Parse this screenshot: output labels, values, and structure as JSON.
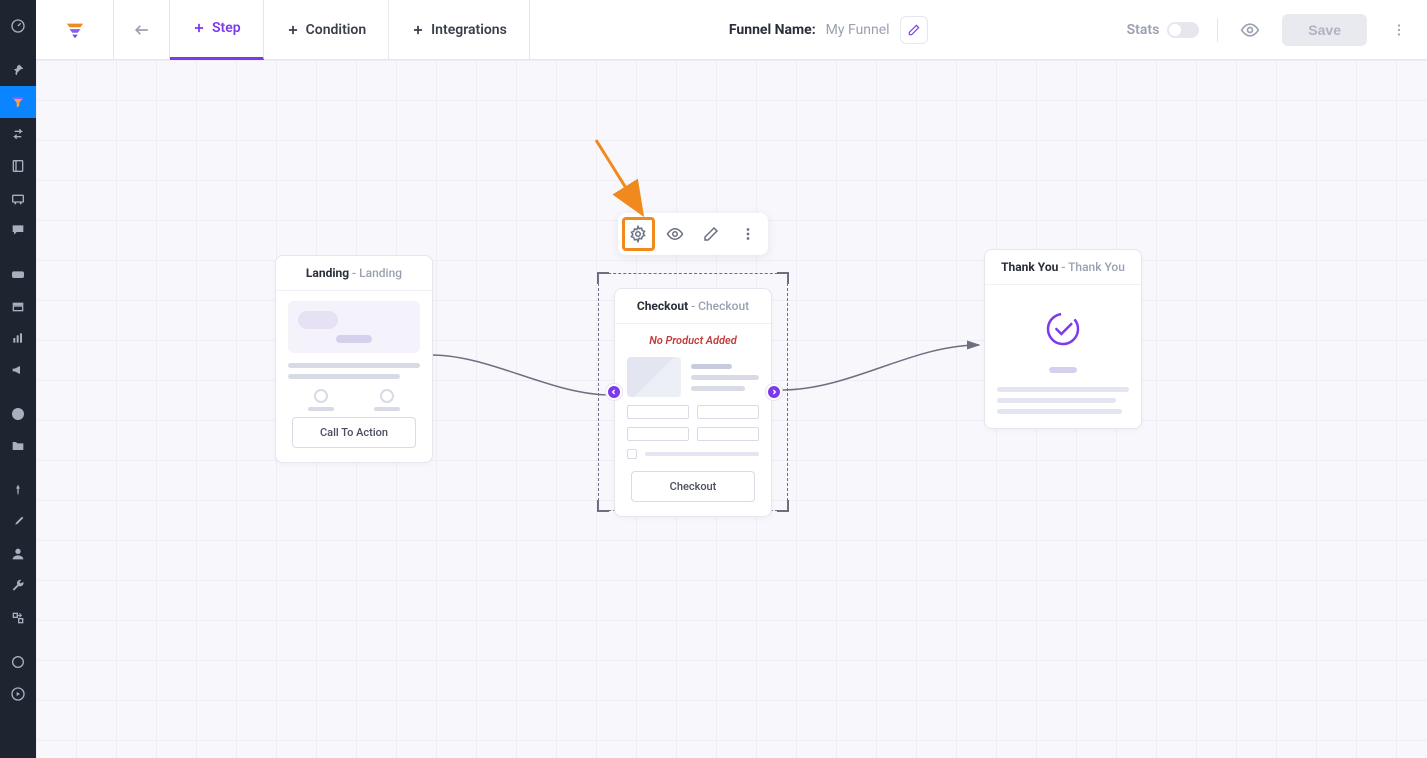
{
  "topbar": {
    "tabs": {
      "step": "Step",
      "condition": "Condition",
      "integrations": "Integrations"
    },
    "funnel_label": "Funnel Name:",
    "funnel_name": "My Funnel",
    "stats_label": "Stats",
    "save_label": "Save"
  },
  "nodes": {
    "landing": {
      "title": "Landing",
      "subtitle": " - Landing",
      "cta": "Call To Action"
    },
    "checkout": {
      "title": "Checkout",
      "subtitle": " - Checkout",
      "warning": "No Product Added",
      "cta": "Checkout"
    },
    "thankyou": {
      "title": "Thank You",
      "subtitle": " - Thank You"
    }
  },
  "sidebar_icons": [
    "dashboard",
    "pin",
    "funnel",
    "swap",
    "book",
    "cart",
    "chat",
    "woo",
    "archive",
    "chart",
    "megaphone",
    "elementor",
    "folder",
    "pin2",
    "brush",
    "user",
    "wrench",
    "transfer",
    "circle-q",
    "play"
  ],
  "colors": {
    "accent": "#7c3aed",
    "highlight": "#f08a1f"
  }
}
